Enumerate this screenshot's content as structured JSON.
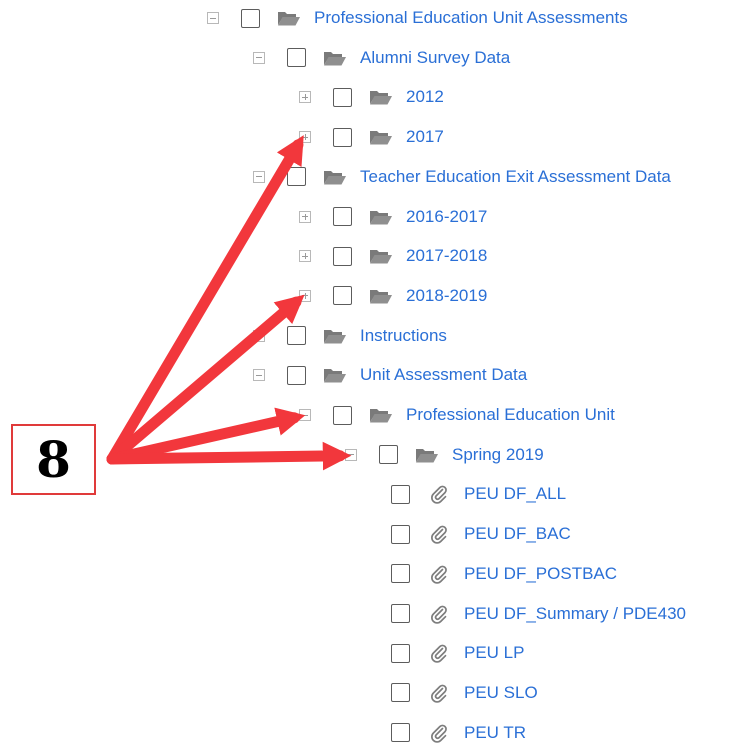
{
  "colors": {
    "link": "#2a6fd6",
    "arrow": "#f2373c",
    "badge_border": "#e03a3a",
    "checkbox_border": "#5c5c5c"
  },
  "tree": [
    {
      "label": "Professional Education Unit Assessments",
      "depth": 0,
      "expander": "minus",
      "icon": "folder-open-icon"
    },
    {
      "label": "Alumni Survey Data",
      "depth": 1,
      "expander": "minus",
      "icon": "folder-open-icon"
    },
    {
      "label": "2012",
      "depth": 2,
      "expander": "plus",
      "icon": "folder-open-icon"
    },
    {
      "label": "2017",
      "depth": 2,
      "expander": "plus",
      "icon": "folder-open-icon"
    },
    {
      "label": "Teacher Education Exit Assessment Data",
      "depth": 1,
      "expander": "minus",
      "icon": "folder-open-icon"
    },
    {
      "label": "2016-2017",
      "depth": 2,
      "expander": "plus",
      "icon": "folder-open-icon"
    },
    {
      "label": "2017-2018",
      "depth": 2,
      "expander": "plus",
      "icon": "folder-open-icon"
    },
    {
      "label": "2018-2019",
      "depth": 2,
      "expander": "plus",
      "icon": "folder-open-icon"
    },
    {
      "label": "Instructions",
      "depth": 1,
      "expander": "minus",
      "icon": "folder-open-icon"
    },
    {
      "label": "Unit Assessment Data",
      "depth": 1,
      "expander": "minus",
      "icon": "folder-open-icon"
    },
    {
      "label": "Professional Education Unit",
      "depth": 2,
      "expander": "minus",
      "icon": "folder-open-icon"
    },
    {
      "label": "Spring 2019",
      "depth": 3,
      "expander": "minus",
      "icon": "folder-open-icon"
    },
    {
      "label": "PEU DF_ALL",
      "depth": 4,
      "expander": "none",
      "icon": "paperclip-icon"
    },
    {
      "label": "PEU DF_BAC",
      "depth": 4,
      "expander": "none",
      "icon": "paperclip-icon"
    },
    {
      "label": "PEU DF_POSTBAC",
      "depth": 4,
      "expander": "none",
      "icon": "paperclip-icon"
    },
    {
      "label": "PEU DF_Summary / PDE430",
      "depth": 4,
      "expander": "none",
      "icon": "paperclip-icon"
    },
    {
      "label": "PEU LP",
      "depth": 4,
      "expander": "none",
      "icon": "paperclip-icon"
    },
    {
      "label": "PEU SLO",
      "depth": 4,
      "expander": "none",
      "icon": "paperclip-icon"
    },
    {
      "label": "PEU TR",
      "depth": 4,
      "expander": "none",
      "icon": "paperclip-icon"
    }
  ],
  "annotation": {
    "badge_label": "8",
    "arrow_targets": [
      "2017",
      "2018-2019",
      "Professional Education Unit",
      "Spring 2019"
    ]
  }
}
